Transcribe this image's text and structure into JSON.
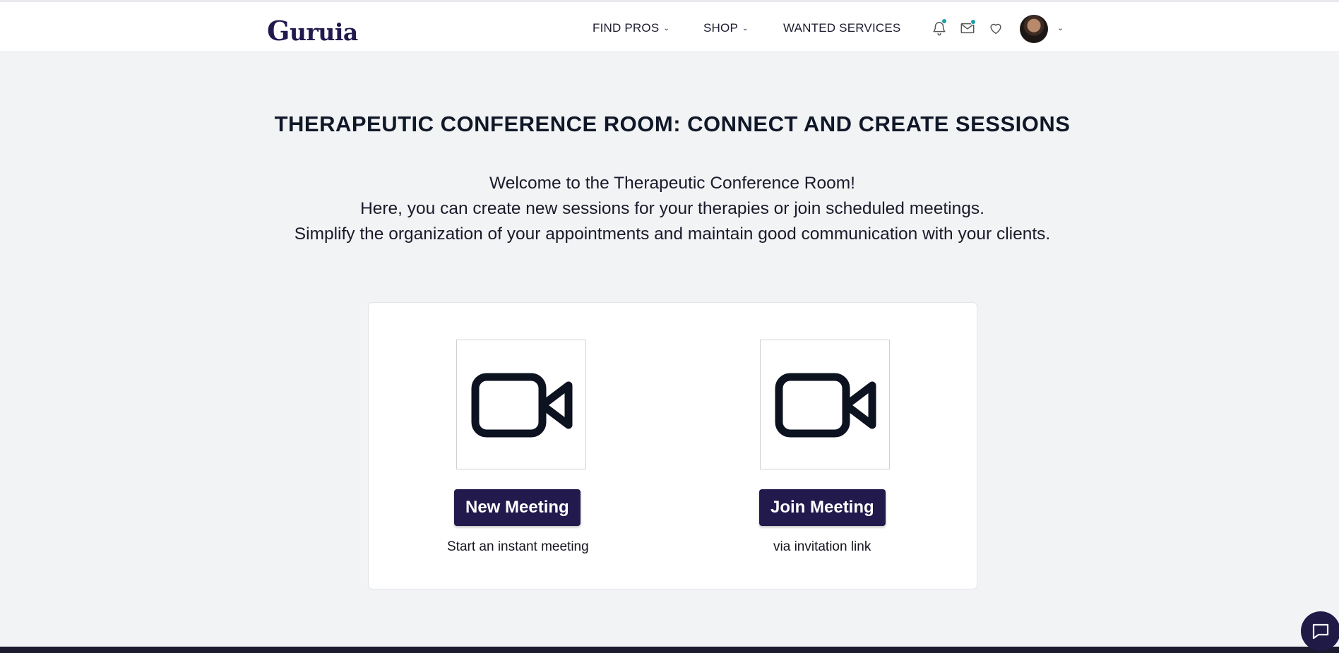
{
  "brand": {
    "logo_initial": "G",
    "logo_rest": "uruia",
    "color": "#22194f"
  },
  "nav": {
    "find_pros": "FIND PROS",
    "shop": "SHOP",
    "wanted_services": "WANTED SERVICES"
  },
  "header_icons": [
    "bell-icon",
    "mail-icon",
    "heart-icon",
    "chevron-down-icon"
  ],
  "page": {
    "title": "THERAPEUTIC CONFERENCE ROOM: CONNECT AND CREATE SESSIONS",
    "intro_lines": [
      "Welcome to the Therapeutic Conference Room!",
      "Here, you can create new sessions for your therapies or join scheduled meetings.",
      "Simplify the organization of your appointments and maintain good communication with your clients."
    ]
  },
  "options": {
    "new_meeting": {
      "button": "New Meeting",
      "caption": "Start an instant meeting",
      "icon": "video-camera-icon"
    },
    "join_meeting": {
      "button": "Join Meeting",
      "caption": "via invitation link",
      "icon": "video-camera-icon"
    }
  },
  "colors": {
    "primary": "#221a4d",
    "notification_dot": "#1a9fa8",
    "page_background": "#f2f3f5"
  }
}
